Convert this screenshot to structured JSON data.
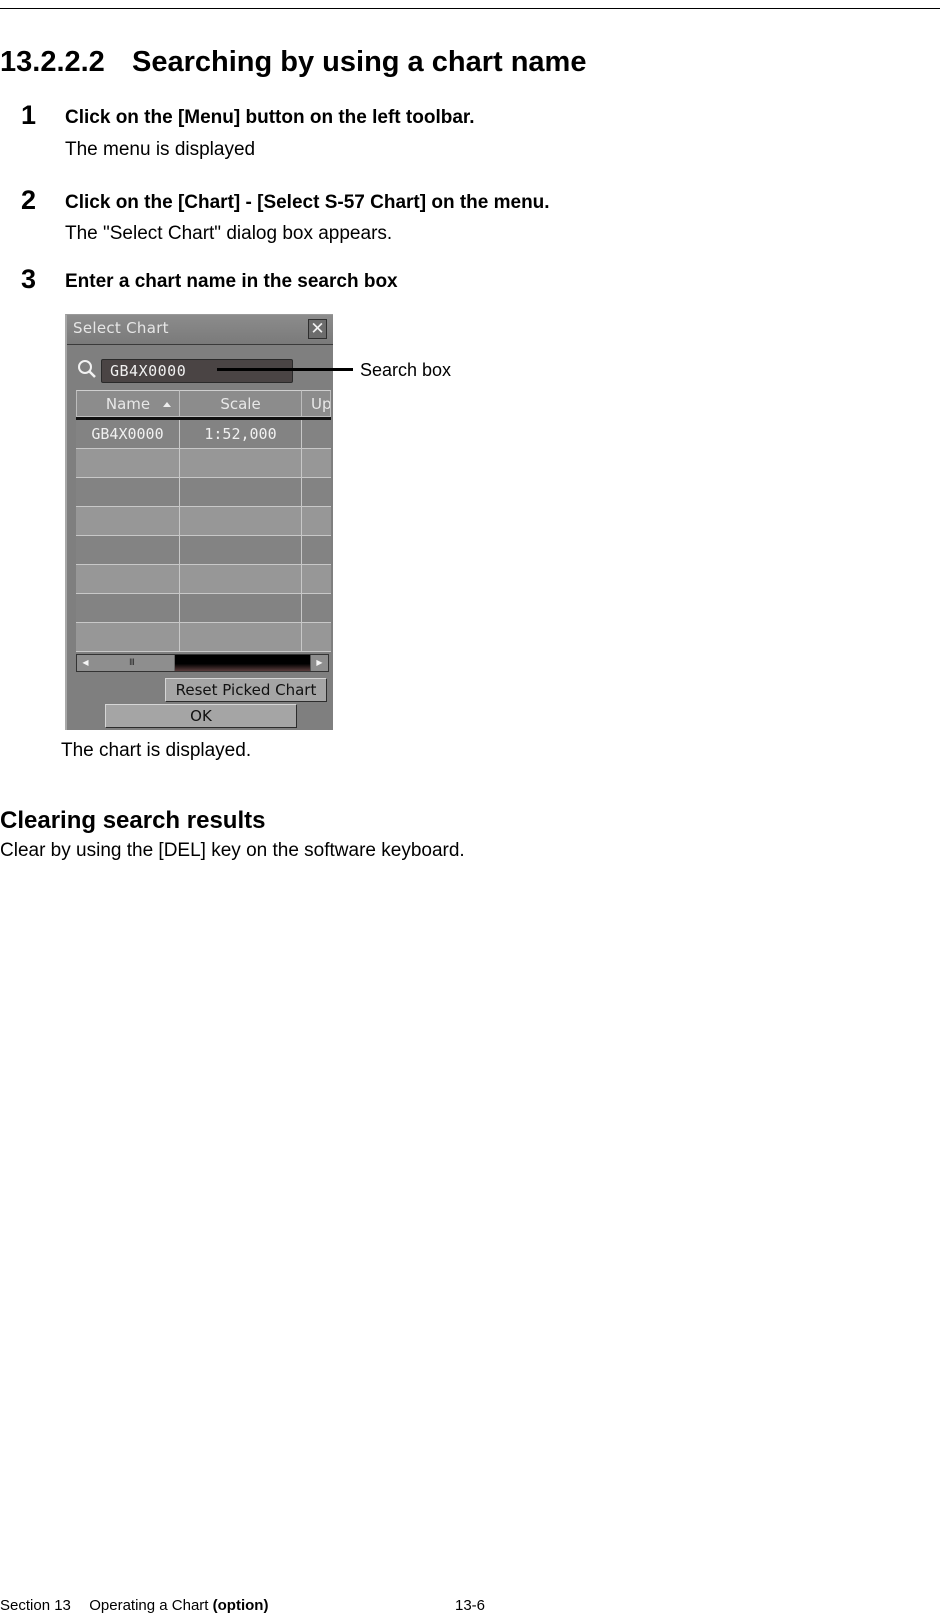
{
  "heading": {
    "number": "13.2.2.2",
    "title": "Searching by using a chart name"
  },
  "steps": [
    {
      "number": "1",
      "instruction": "Click on the [Menu] button on the left toolbar.",
      "result": "The menu is displayed"
    },
    {
      "number": "2",
      "instruction": "Click on the [Chart] - [Select S-57 Chart] on the menu.",
      "result": "The \"Select Chart\" dialog box appears."
    },
    {
      "number": "3",
      "instruction": "Enter a chart name in the search box",
      "result": "The chart is displayed."
    }
  ],
  "dialog": {
    "title": "Select Chart",
    "close_symbol": "✕",
    "search_value": "GB4X0000",
    "columns": [
      {
        "label": "Name",
        "sorted": "ascending"
      },
      {
        "label": "Scale"
      },
      {
        "label": "Up"
      }
    ],
    "rows": [
      [
        "GB4X0000",
        "1:52,000",
        ""
      ],
      [
        "",
        "",
        ""
      ],
      [
        "",
        "",
        ""
      ],
      [
        "",
        "",
        ""
      ],
      [
        "",
        "",
        ""
      ],
      [
        "",
        "",
        ""
      ],
      [
        "",
        "",
        ""
      ],
      [
        "",
        "",
        ""
      ]
    ],
    "scroll_left_symbol": "◀",
    "scroll_right_symbol": "▶",
    "scroll_grip": "III",
    "reset_button": "Reset Picked Chart",
    "ok_button": "OK"
  },
  "callout": {
    "label": "Search box"
  },
  "section": {
    "title": "Clearing search results",
    "text": "Clear by using the [DEL] key on the software keyboard."
  },
  "footer": {
    "section": "Section 13",
    "chapter": "Operating a Chart",
    "chapter_suffix": "(option)",
    "page": "13-6"
  }
}
